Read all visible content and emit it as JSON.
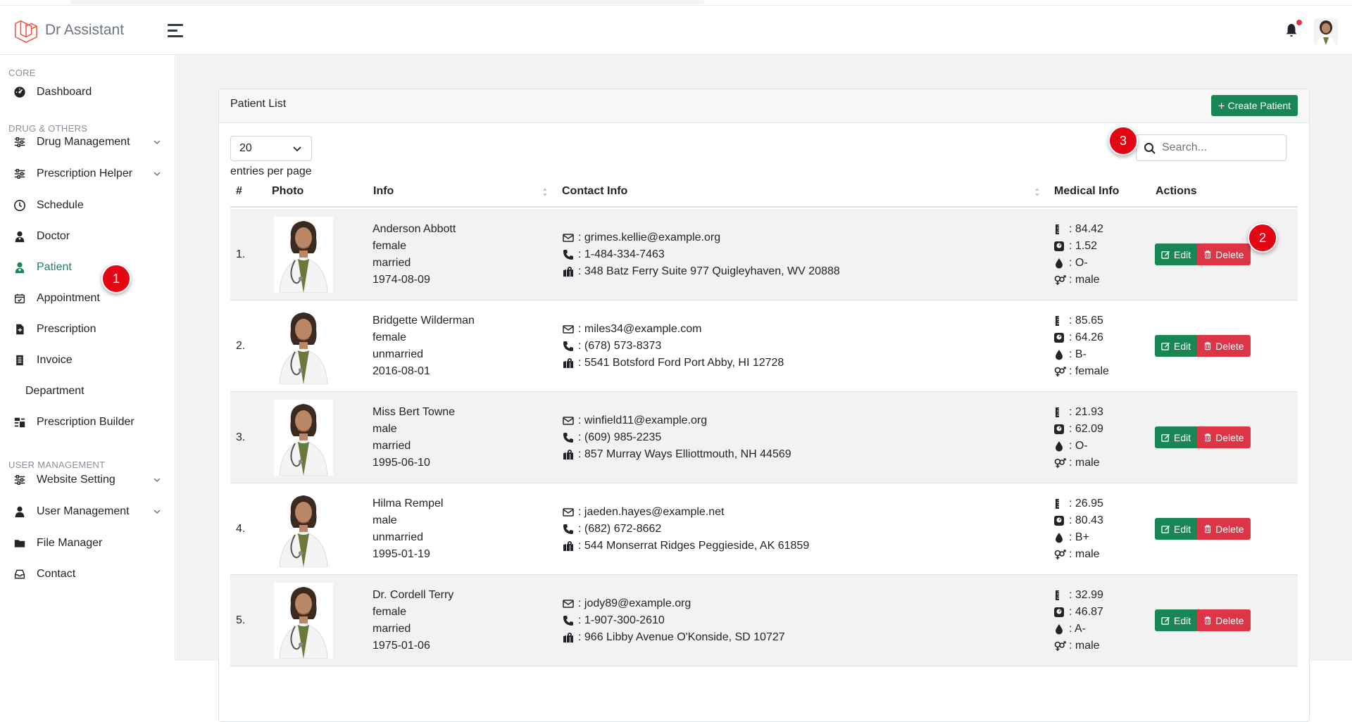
{
  "app": {
    "brand_name": "Dr Assistant"
  },
  "sidebar": {
    "headings": [
      "CORE",
      "DRUG & OTHERS",
      "USER MANAGEMENT"
    ],
    "items": [
      {
        "label": "Dashboard"
      },
      {
        "label": "Drug Management"
      },
      {
        "label": "Prescription Helper"
      },
      {
        "label": "Schedule"
      },
      {
        "label": "Doctor"
      },
      {
        "label": "Patient"
      },
      {
        "label": "Appointment"
      },
      {
        "label": "Prescription"
      },
      {
        "label": "Invoice"
      },
      {
        "label": "Department"
      },
      {
        "label": "Prescription Builder"
      },
      {
        "label": "Website Setting"
      },
      {
        "label": "User Management"
      },
      {
        "label": "File Manager"
      },
      {
        "label": "Contact"
      }
    ],
    "active": "Patient"
  },
  "main": {
    "card_title": "Patient List",
    "create_button": "Create Patient",
    "entries": {
      "value": "20",
      "label": "entries per page"
    },
    "search": {
      "placeholder": "Search..."
    },
    "columns": [
      "#",
      "Photo",
      "Info",
      "Contact Info",
      "Medical Info",
      "Actions"
    ],
    "edit_label": "Edit",
    "delete_label": "Delete",
    "rows": [
      {
        "num": "1.",
        "info": [
          "Anderson Abbott",
          "female",
          "married",
          "1974-08-09"
        ],
        "contact": [
          ": grimes.kellie@example.org",
          ": 1-484-334-7463",
          ": 348 Batz Ferry Suite 977 Quigleyhaven, WV 20888"
        ],
        "medical": [
          ": 84.42",
          ": 1.52",
          ": O-",
          ": male"
        ]
      },
      {
        "num": "2.",
        "info": [
          "Bridgette Wilderman",
          "female",
          "unmarried",
          "2016-08-01"
        ],
        "contact": [
          ": miles34@example.com",
          ": (678) 573-8373",
          ": 5541 Botsford Ford Port Abby, HI 12728"
        ],
        "medical": [
          ": 85.65",
          ": 64.26",
          ": B-",
          ": female"
        ]
      },
      {
        "num": "3.",
        "info": [
          "Miss Bert Towne",
          "male",
          "married",
          "1995-06-10"
        ],
        "contact": [
          ": winfield11@example.org",
          ": (609) 985-2235",
          ": 857 Murray Ways Elliottmouth, NH 44569"
        ],
        "medical": [
          ": 21.93",
          ": 62.09",
          ": O-",
          ": male"
        ]
      },
      {
        "num": "4.",
        "info": [
          "Hilma Rempel",
          "male",
          "unmarried",
          "1995-01-19"
        ],
        "contact": [
          ": jaeden.hayes@example.net",
          ": (682) 672-8662",
          ": 544 Monserrat Ridges Peggieside, AK 61859"
        ],
        "medical": [
          ": 26.95",
          ": 80.43",
          ": B+",
          ": male"
        ]
      },
      {
        "num": "5.",
        "info": [
          "Dr. Cordell Terry",
          "female",
          "married",
          "1975-01-06"
        ],
        "contact": [
          ": jody89@example.org",
          ": 1-907-300-2610",
          ": 966 Libby Avenue O'Konside, SD 10727"
        ],
        "medical": [
          ": 32.99",
          ": 46.87",
          ": A-",
          ": male"
        ]
      }
    ]
  },
  "step_badges": [
    "1",
    "2",
    "3"
  ],
  "colors": {
    "primary_green": "#198754",
    "danger_red": "#dc3545",
    "badge_red": "#e30613"
  }
}
